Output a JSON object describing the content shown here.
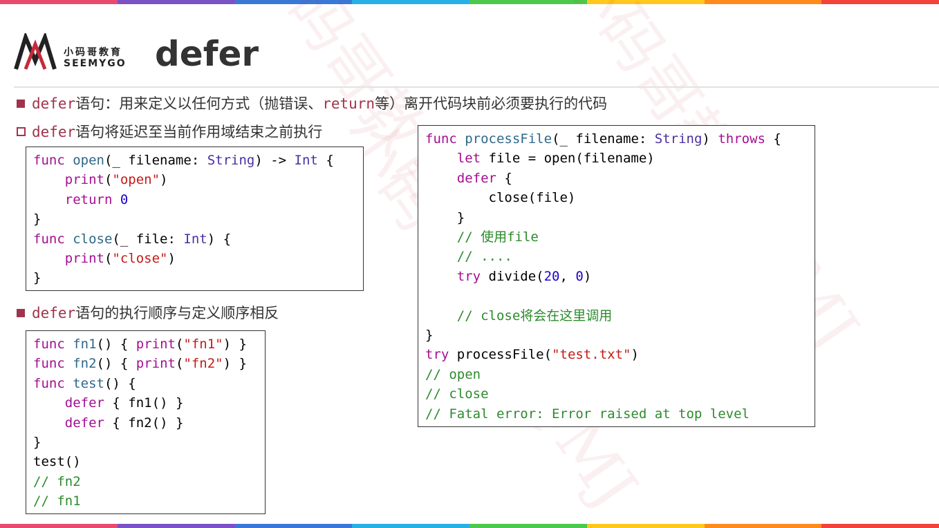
{
  "colors": {
    "accent": "#a0334c",
    "rainbow": [
      "#e94b6f",
      "#7b51c6",
      "#3a78d8",
      "#27b0e6",
      "#4cc94c",
      "#ffc81e",
      "#ff8a1e",
      "#f2423a"
    ]
  },
  "logo": {
    "cn": "小码哥教育",
    "en": "SEEMYGO"
  },
  "title": "defer",
  "watermark": "小码哥教育@MJ",
  "bullets": [
    {
      "kw": "defer",
      "text_a": "语句：用来定义以任何方式（抛错误、",
      "kw2": "return",
      "text_b": "等）离开代码块前必须要执行的代码"
    },
    {
      "kw": "defer",
      "text": "语句将延迟至当前作用域结束之前执行"
    },
    {
      "kw": "defer",
      "text": "语句的执行顺序与定义顺序相反"
    }
  ],
  "code1": {
    "func": "func",
    "open": "open",
    "filename_p": "(_ filename: ",
    "String": "String",
    "arrow": ") -> ",
    "Int": "Int",
    "brace": " {",
    "print": "print",
    "s_open": "\"open\"",
    "return": "return",
    "zero": "0",
    "close_brace": "}",
    "close": "close",
    "file_p": "(_ file: ",
    "s_close": "\"close\"",
    "paren_close": ") {"
  },
  "code2": {
    "func": "func",
    "fn1": "fn1",
    "fn2": "fn2",
    "test": "test",
    "print": "print",
    "s_fn1": "\"fn1\"",
    "s_fn2": "\"fn2\"",
    "defer": "defer",
    "c_fn2": "// fn2",
    "c_fn1": "// fn1"
  },
  "code3": {
    "func": "func",
    "processFile": "processFile",
    "filename_p": "(_ filename: ",
    "String": "String",
    "throws": "throws",
    "let": "let",
    "file_eq": " file = open(filename)",
    "defer": "defer",
    "close_file": "close(file)",
    "c_use": "// 使用file",
    "c_dots": "// ....",
    "try": "try",
    "divide": " divide(",
    "n20": "20",
    "n0": "0",
    "c_close": "// close将会在这里调用",
    "s_test": "\"test.txt\"",
    "c_open": "// open",
    "c_close2": "// close",
    "c_fatal": "// Fatal error: Error raised at top level"
  }
}
